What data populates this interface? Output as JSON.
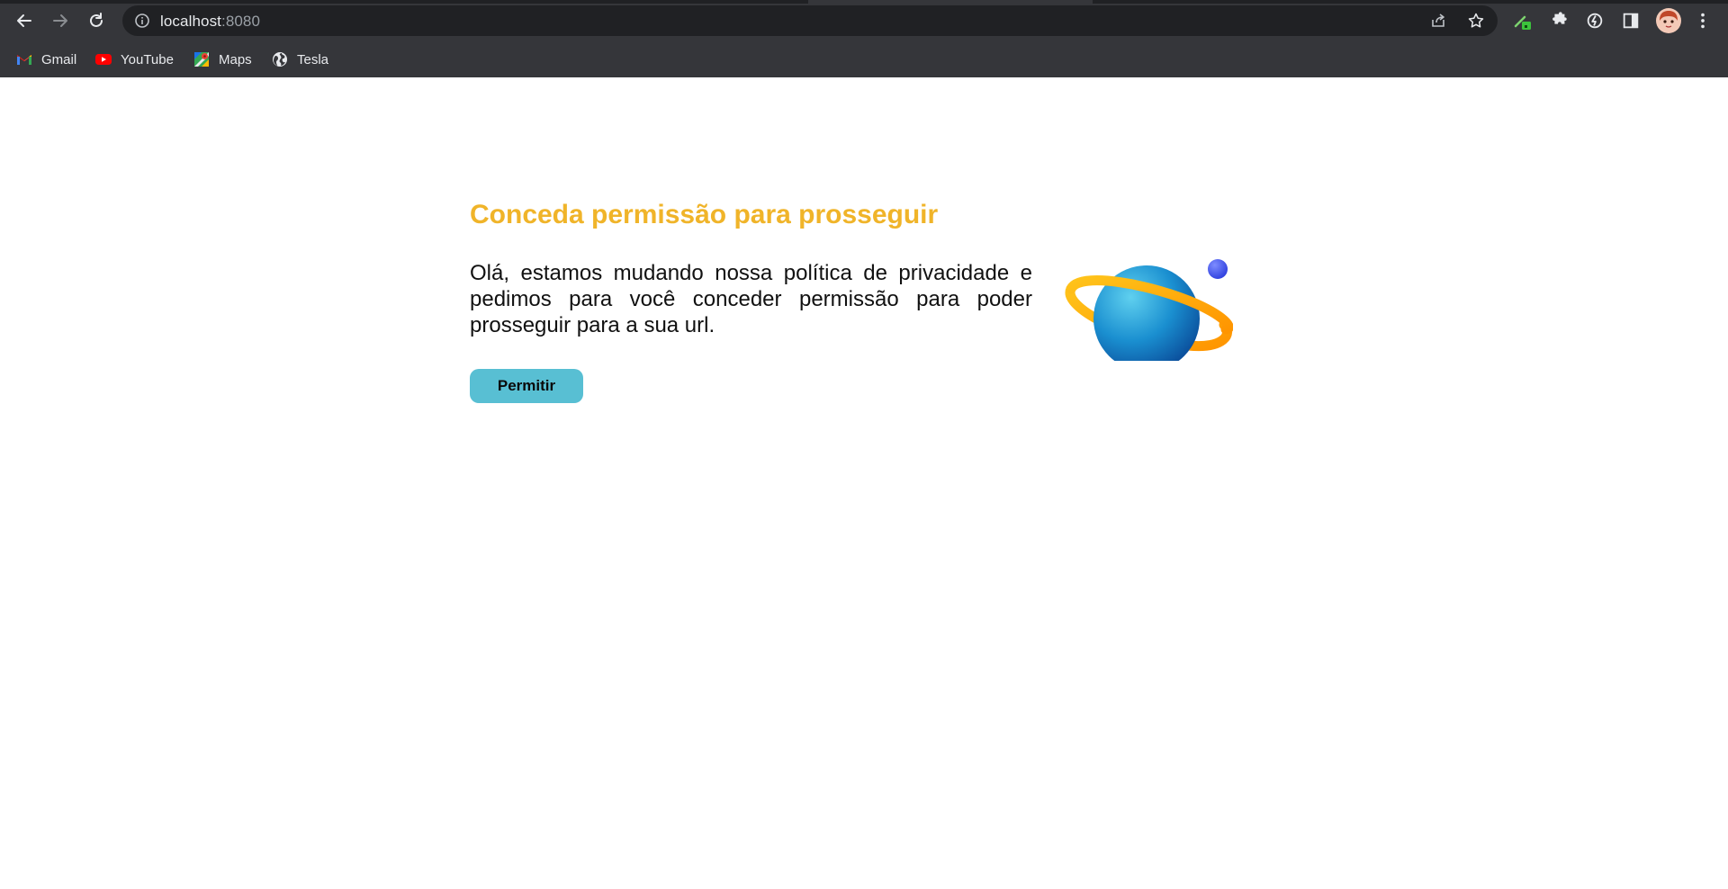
{
  "browser": {
    "url_host": "localhost",
    "url_port": ":8080",
    "bookmarks": [
      {
        "label": "Gmail",
        "icon": "gmail-icon"
      },
      {
        "label": "YouTube",
        "icon": "youtube-icon"
      },
      {
        "label": "Maps",
        "icon": "maps-icon"
      },
      {
        "label": "Tesla",
        "icon": "globe-icon"
      }
    ]
  },
  "page": {
    "title": "Conceda permissão para prosseguir",
    "message": "Olá, estamos mudando nossa política de privacidade e pedimos para você conceder permissão para poder prosseguir para a sua url.",
    "button_label": "Permitir",
    "colors": {
      "title": "#f0b429",
      "button": "#58bfd3",
      "planet_body": "#1a8fd0",
      "planet_ring": "#ffa600",
      "moon": "#4a5cf0"
    }
  }
}
